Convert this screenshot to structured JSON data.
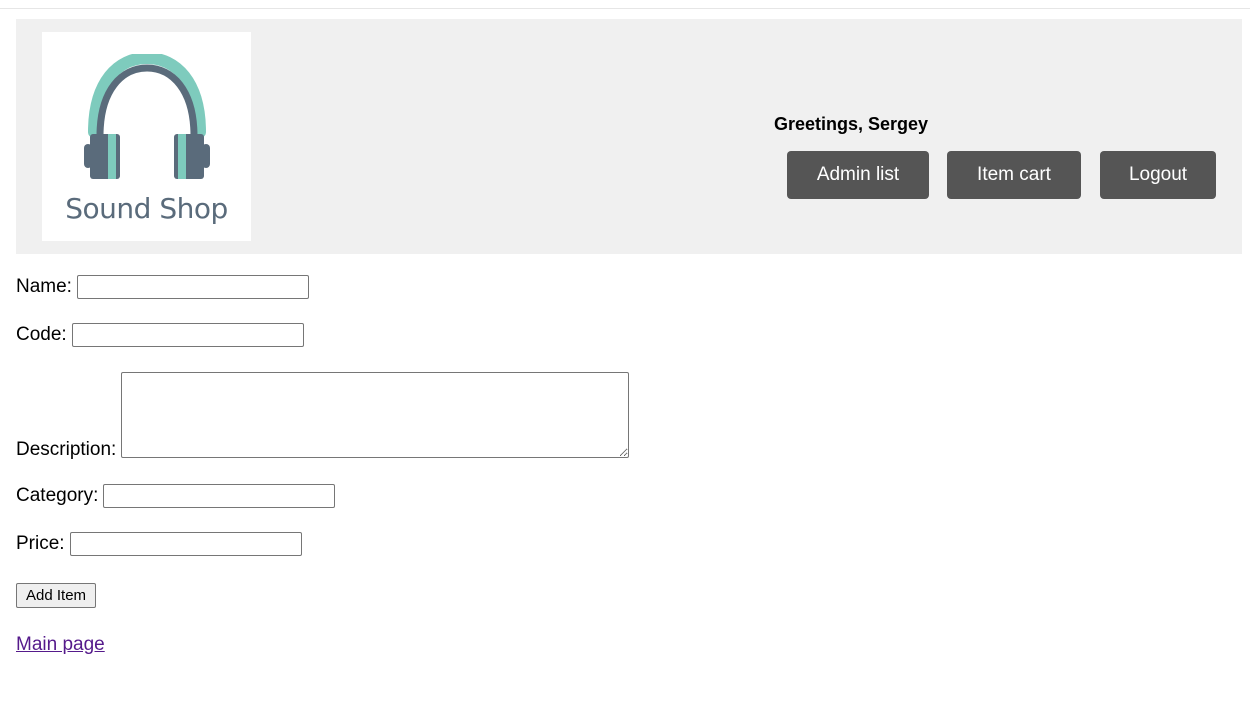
{
  "header": {
    "logo_text": "Sound Shop",
    "greeting": "Greetings, Sergey",
    "buttons": {
      "admin_list": "Admin list",
      "item_cart": "Item cart",
      "logout": "Logout"
    }
  },
  "form": {
    "name_label": "Name:",
    "name_value": "",
    "code_label": "Code:",
    "code_value": "",
    "description_label": "Description:",
    "description_value": "",
    "category_label": "Category:",
    "category_value": "",
    "price_label": "Price:",
    "price_value": "",
    "submit_label": "Add Item"
  },
  "footer": {
    "main_page_link": "Main page"
  },
  "colors": {
    "header_bg": "#f0f0f0",
    "button_bg": "#555555",
    "logo_teal": "#7ecbbd",
    "logo_slate": "#5a6b7b",
    "visited_link": "#551a8b"
  },
  "icons": {
    "logo": "headphones-icon"
  }
}
